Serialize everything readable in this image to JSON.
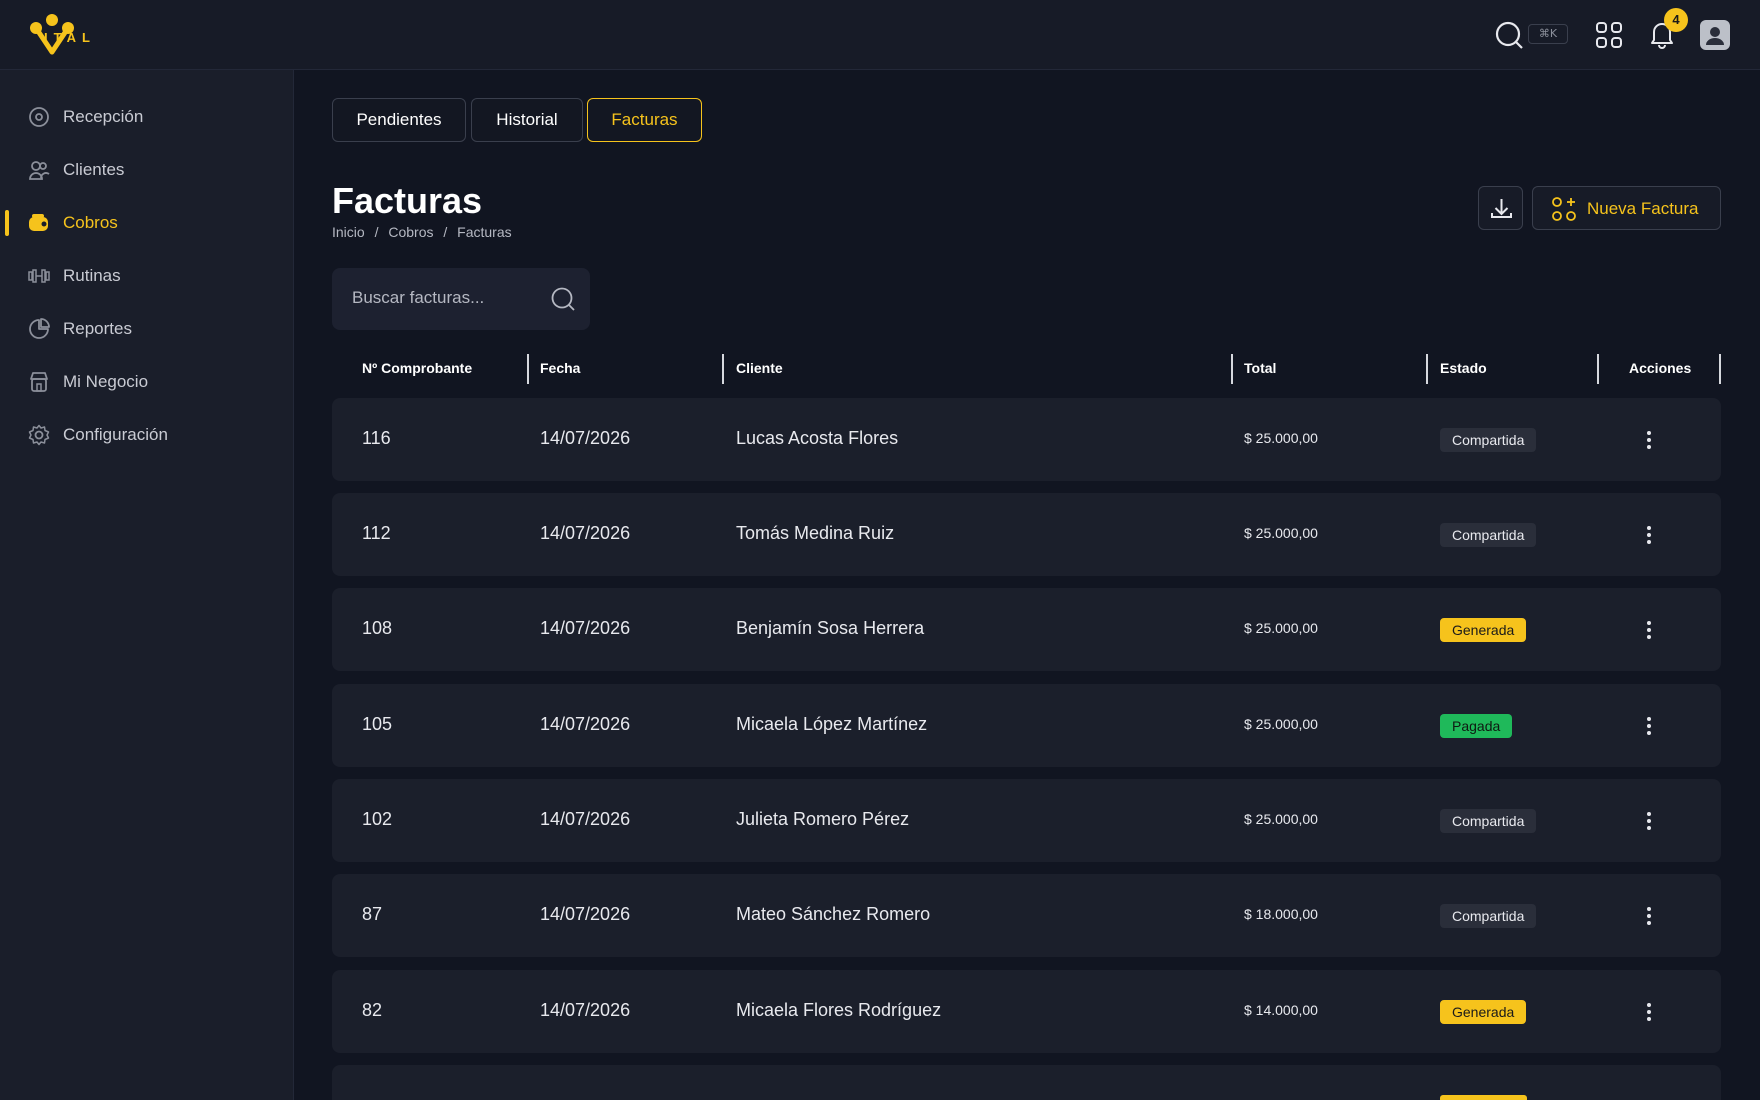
{
  "app": {
    "logo_text": "ITAL",
    "brand_color": "#f6c31c"
  },
  "topbar": {
    "search_shortcut": "⌘K",
    "notifications_count": "4",
    "icons": [
      "search-icon",
      "apps-icon",
      "bell-icon",
      "user-avatar-icon"
    ]
  },
  "sidebar": {
    "items": [
      {
        "label": "Recepción",
        "icon": "reception-icon"
      },
      {
        "label": "Clientes",
        "icon": "clients-icon"
      },
      {
        "label": "Cobros",
        "icon": "wallet-icon",
        "active": true
      },
      {
        "label": "Rutinas",
        "icon": "dumbbell-icon"
      },
      {
        "label": "Reportes",
        "icon": "pie-chart-icon"
      },
      {
        "label": "Mi Negocio",
        "icon": "store-icon"
      },
      {
        "label": "Configuración",
        "icon": "gear-icon"
      }
    ]
  },
  "tabs": [
    {
      "label": "Pendientes"
    },
    {
      "label": "Historial"
    },
    {
      "label": "Facturas",
      "active": true
    }
  ],
  "page": {
    "title": "Facturas",
    "breadcrumb": [
      "Inicio",
      "/",
      "Cobros",
      "/",
      "Facturas"
    ],
    "new_button_label": "Nueva Factura"
  },
  "search": {
    "placeholder": "Buscar facturas..."
  },
  "table": {
    "columns": [
      "Nº Comprobante",
      "Fecha",
      "Cliente",
      "Total",
      "Estado",
      "Acciones"
    ],
    "rows": [
      {
        "num": "116",
        "fecha": "14/07/2026",
        "cliente": "Lucas Acosta Flores",
        "total": "$ 25.000,00",
        "estado": "Compartida",
        "estado_color": "gray"
      },
      {
        "num": "112",
        "fecha": "14/07/2026",
        "cliente": "Tomás Medina Ruiz",
        "total": "$ 25.000,00",
        "estado": "Compartida",
        "estado_color": "gray"
      },
      {
        "num": "108",
        "fecha": "14/07/2026",
        "cliente": "Benjamín Sosa Herrera",
        "total": "$ 25.000,00",
        "estado": "Generada",
        "estado_color": "yellow"
      },
      {
        "num": "105",
        "fecha": "14/07/2026",
        "cliente": "Micaela López Martínez",
        "total": "$ 25.000,00",
        "estado": "Pagada",
        "estado_color": "green"
      },
      {
        "num": "102",
        "fecha": "14/07/2026",
        "cliente": "Julieta Romero Pérez",
        "total": "$ 25.000,00",
        "estado": "Compartida",
        "estado_color": "gray"
      },
      {
        "num": "87",
        "fecha": "14/07/2026",
        "cliente": "Mateo Sánchez Romero",
        "total": "$ 18.000,00",
        "estado": "Compartida",
        "estado_color": "gray"
      },
      {
        "num": "82",
        "fecha": "14/07/2026",
        "cliente": "Micaela Flores Rodríguez",
        "total": "$ 14.000,00",
        "estado": "Generada",
        "estado_color": "yellow"
      }
    ]
  }
}
